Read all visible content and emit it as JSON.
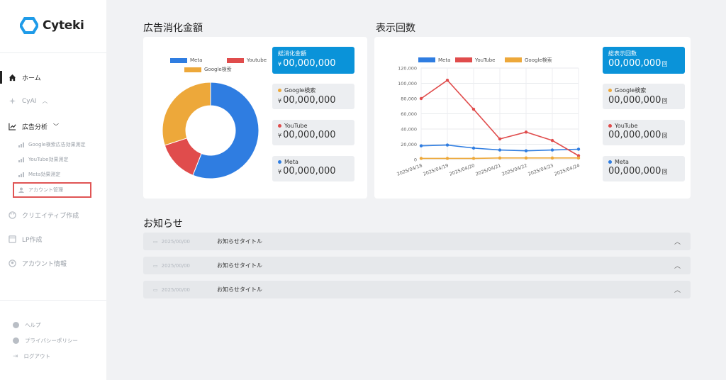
{
  "app": {
    "name": "Cyteki"
  },
  "sidebar": {
    "items": [
      {
        "label": "ホーム",
        "icon": "home-icon"
      },
      {
        "label": "CyAI",
        "icon": "sparkle-icon"
      },
      {
        "label": "広告分析",
        "icon": "trend-icon"
      }
    ],
    "sub_items": [
      {
        "label": "Google検索広告効果測定"
      },
      {
        "label": "YouTube効果測定"
      },
      {
        "label": "Meta効果測定"
      },
      {
        "label": "アカウント管理"
      }
    ],
    "more_items": [
      {
        "label": "クリエイティブ作成",
        "icon": "palette-icon"
      },
      {
        "label": "LP作成",
        "icon": "page-icon"
      },
      {
        "label": "アカウント情報",
        "icon": "user-circle-icon"
      }
    ],
    "footer": [
      {
        "label": "ヘルプ"
      },
      {
        "label": "プライバシーポリシー"
      },
      {
        "label": "ログアウト"
      }
    ]
  },
  "spend": {
    "title": "広告消化金額",
    "legend": [
      "Meta",
      "Youtube",
      "Google検索"
    ],
    "total_label": "総消化金額",
    "total_value": "00,000,000",
    "currency": "¥",
    "items": [
      {
        "label": "Google検索",
        "value": "00,000,000",
        "color": "#eda83a"
      },
      {
        "label": "YouTube",
        "value": "00,000,000",
        "color": "#e04c4c"
      },
      {
        "label": "Meta",
        "value": "00,000,000",
        "color": "#2f7de1"
      }
    ]
  },
  "impressions": {
    "title": "表示回数",
    "total_label": "総表示回数",
    "total_value": "00,000,000",
    "unit": "回",
    "items": [
      {
        "label": "Google検索",
        "value": "00,000,000",
        "color": "#eda83a"
      },
      {
        "label": "YouTube",
        "value": "00,000,000",
        "color": "#e04c4c"
      },
      {
        "label": "Meta",
        "value": "00,000,000",
        "color": "#2f7de1"
      }
    ]
  },
  "chart_data": [
    {
      "type": "pie",
      "categories": [
        "Meta",
        "Youtube",
        "Google検索"
      ],
      "values": [
        56,
        14,
        30
      ],
      "colors": [
        "#2f7de1",
        "#e04c4c",
        "#eda83a"
      ],
      "donut": true,
      "legend": "top"
    },
    {
      "type": "line",
      "x": [
        "2025/04/18",
        "2025/04/19",
        "2025/04/20",
        "2025/04/21",
        "2025/04/22",
        "2025/04/23",
        "2025/04/24"
      ],
      "series": [
        {
          "name": "Meta",
          "values": [
            18000,
            19000,
            15000,
            12500,
            11500,
            12500,
            13500
          ],
          "color": "#2f7de1"
        },
        {
          "name": "YouTube",
          "values": [
            80000,
            104000,
            66000,
            27000,
            36000,
            25000,
            5000
          ],
          "color": "#e04c4c"
        },
        {
          "name": "Google検索",
          "values": [
            1500,
            1500,
            1500,
            2000,
            2000,
            2000,
            2000
          ],
          "color": "#eda83a"
        }
      ],
      "ylim": [
        0,
        120000
      ],
      "yticks": [
        "0",
        "20,000",
        "40,000",
        "60,000",
        "80,000",
        "100,000",
        "120,000"
      ],
      "grid": true,
      "legend": "top"
    }
  ],
  "news": {
    "title": "お知らせ",
    "items": [
      {
        "date": "2025/00/00",
        "title": "お知らせタイトル"
      },
      {
        "date": "2025/00/00",
        "title": "お知らせタイトル"
      },
      {
        "date": "2025/00/00",
        "title": "お知らせタイトル"
      }
    ]
  }
}
